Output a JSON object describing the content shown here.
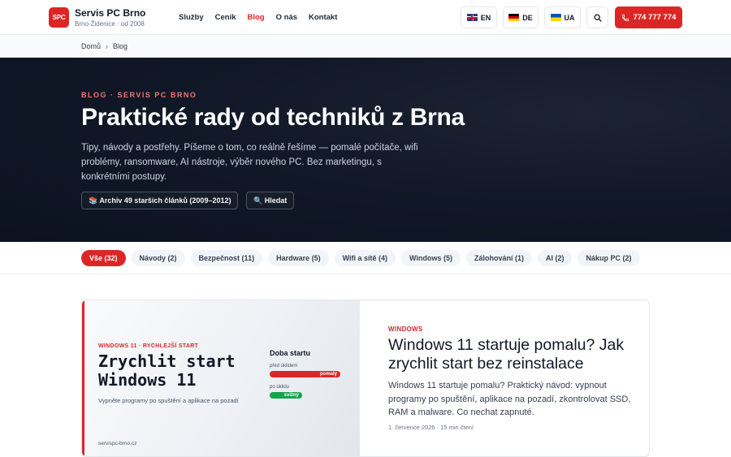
{
  "header": {
    "logo_badge": "SPC",
    "brand_name": "Servis PC Brno",
    "brand_sub": "Brno-Židenice · od 2008",
    "nav": [
      {
        "label": "Služby",
        "active": false
      },
      {
        "label": "Ceník",
        "active": false
      },
      {
        "label": "Blog",
        "active": true
      },
      {
        "label": "O nás",
        "active": false
      },
      {
        "label": "Kontakt",
        "active": false
      }
    ],
    "languages": [
      {
        "code": "EN",
        "flag": "flag-uk-icon"
      },
      {
        "code": "DE",
        "flag": "flag-de-icon"
      },
      {
        "code": "UA",
        "flag": "flag-ua-icon"
      }
    ],
    "search_icon": "search-icon",
    "phone_label": "774 777 774",
    "accent_color": "#dc2626"
  },
  "breadcrumb": {
    "home": "Domů",
    "separator": "›",
    "current": "Blog"
  },
  "hero": {
    "eyebrow": "BLOG · SERVIS PC BRNO",
    "title": "Praktické rady od techniků z Brna",
    "description": "Tipy, návody a postřehy. Píšeme o tom, co reálně řešíme — pomalé počítače, wifi problémy, ransomware, AI nástroje, výběr nového PC. Bez marketingu, s konkrétními postupy.",
    "archive_button": "📚 Archiv 49 starších článků (2009–2012)",
    "search_button": "🔍 Hledat"
  },
  "filters": [
    {
      "label": "Vše (32)",
      "active": true
    },
    {
      "label": "Návody (2)",
      "active": false
    },
    {
      "label": "Bezpečnost (11)",
      "active": false
    },
    {
      "label": "Hardware (5)",
      "active": false
    },
    {
      "label": "Wifi a sítě (4)",
      "active": false
    },
    {
      "label": "Windows (5)",
      "active": false
    },
    {
      "label": "Zálohování (1)",
      "active": false
    },
    {
      "label": "AI (2)",
      "active": false
    },
    {
      "label": "Nákup PC (2)",
      "active": false
    }
  ],
  "featured": {
    "thumb": {
      "eyebrow": "WINDOWS 11 · RYCHLEJŠÍ START",
      "title": "Zrychlit start Windows 11",
      "subtitle": "Vypněte programy po spuštění a aplikace na pozadí",
      "url": "servispc-brno.cz",
      "chart_title": "Doba startu",
      "before_label": "před úklidem",
      "before_value": "pomalý",
      "after_label": "po úklidu",
      "after_value": "svižný",
      "before_fraction": 1.0,
      "after_fraction": 0.46
    },
    "category": "WINDOWS",
    "title": "Windows 11 startuje pomalu? Jak zrychlit start bez reinstalace",
    "excerpt": "Windows 11 startuje pomalu? Praktický návod: vypnout programy po spuštění, aplikace na pozadí, zkontrolovat SSD, RAM a malware. Co nechat zapnuté.",
    "meta": "1. července 2026 · 15 min čtení"
  }
}
